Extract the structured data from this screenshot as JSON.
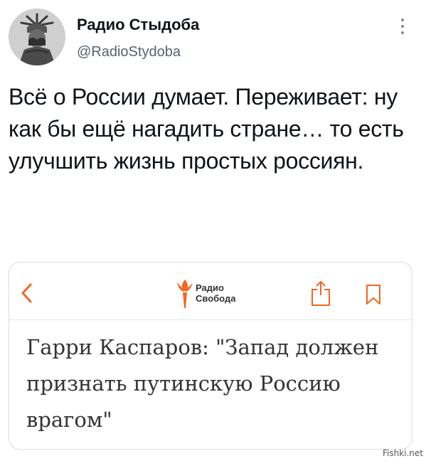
{
  "tweet": {
    "author_name": "Радио Стыдоба",
    "author_handle": "@RadioStydoba",
    "text": "Всё о России думает. Переживает: ну как бы ещё нагадить стране… то есть улучшить жизнь простых россиян."
  },
  "card": {
    "logo_line1": "Радио",
    "logo_line2": "Свобода",
    "headline": "Гарри Каспаров: \"Запад должен признать путинскую Россию врагом\""
  },
  "watermark": "Fishki.net",
  "colors": {
    "accent_orange": "#f26722",
    "text": "#0f1419",
    "secondary_text": "#536471"
  },
  "icons": {
    "more": "vertical-dots",
    "back": "chevron-left",
    "share": "share-upload",
    "bookmark": "bookmark"
  }
}
